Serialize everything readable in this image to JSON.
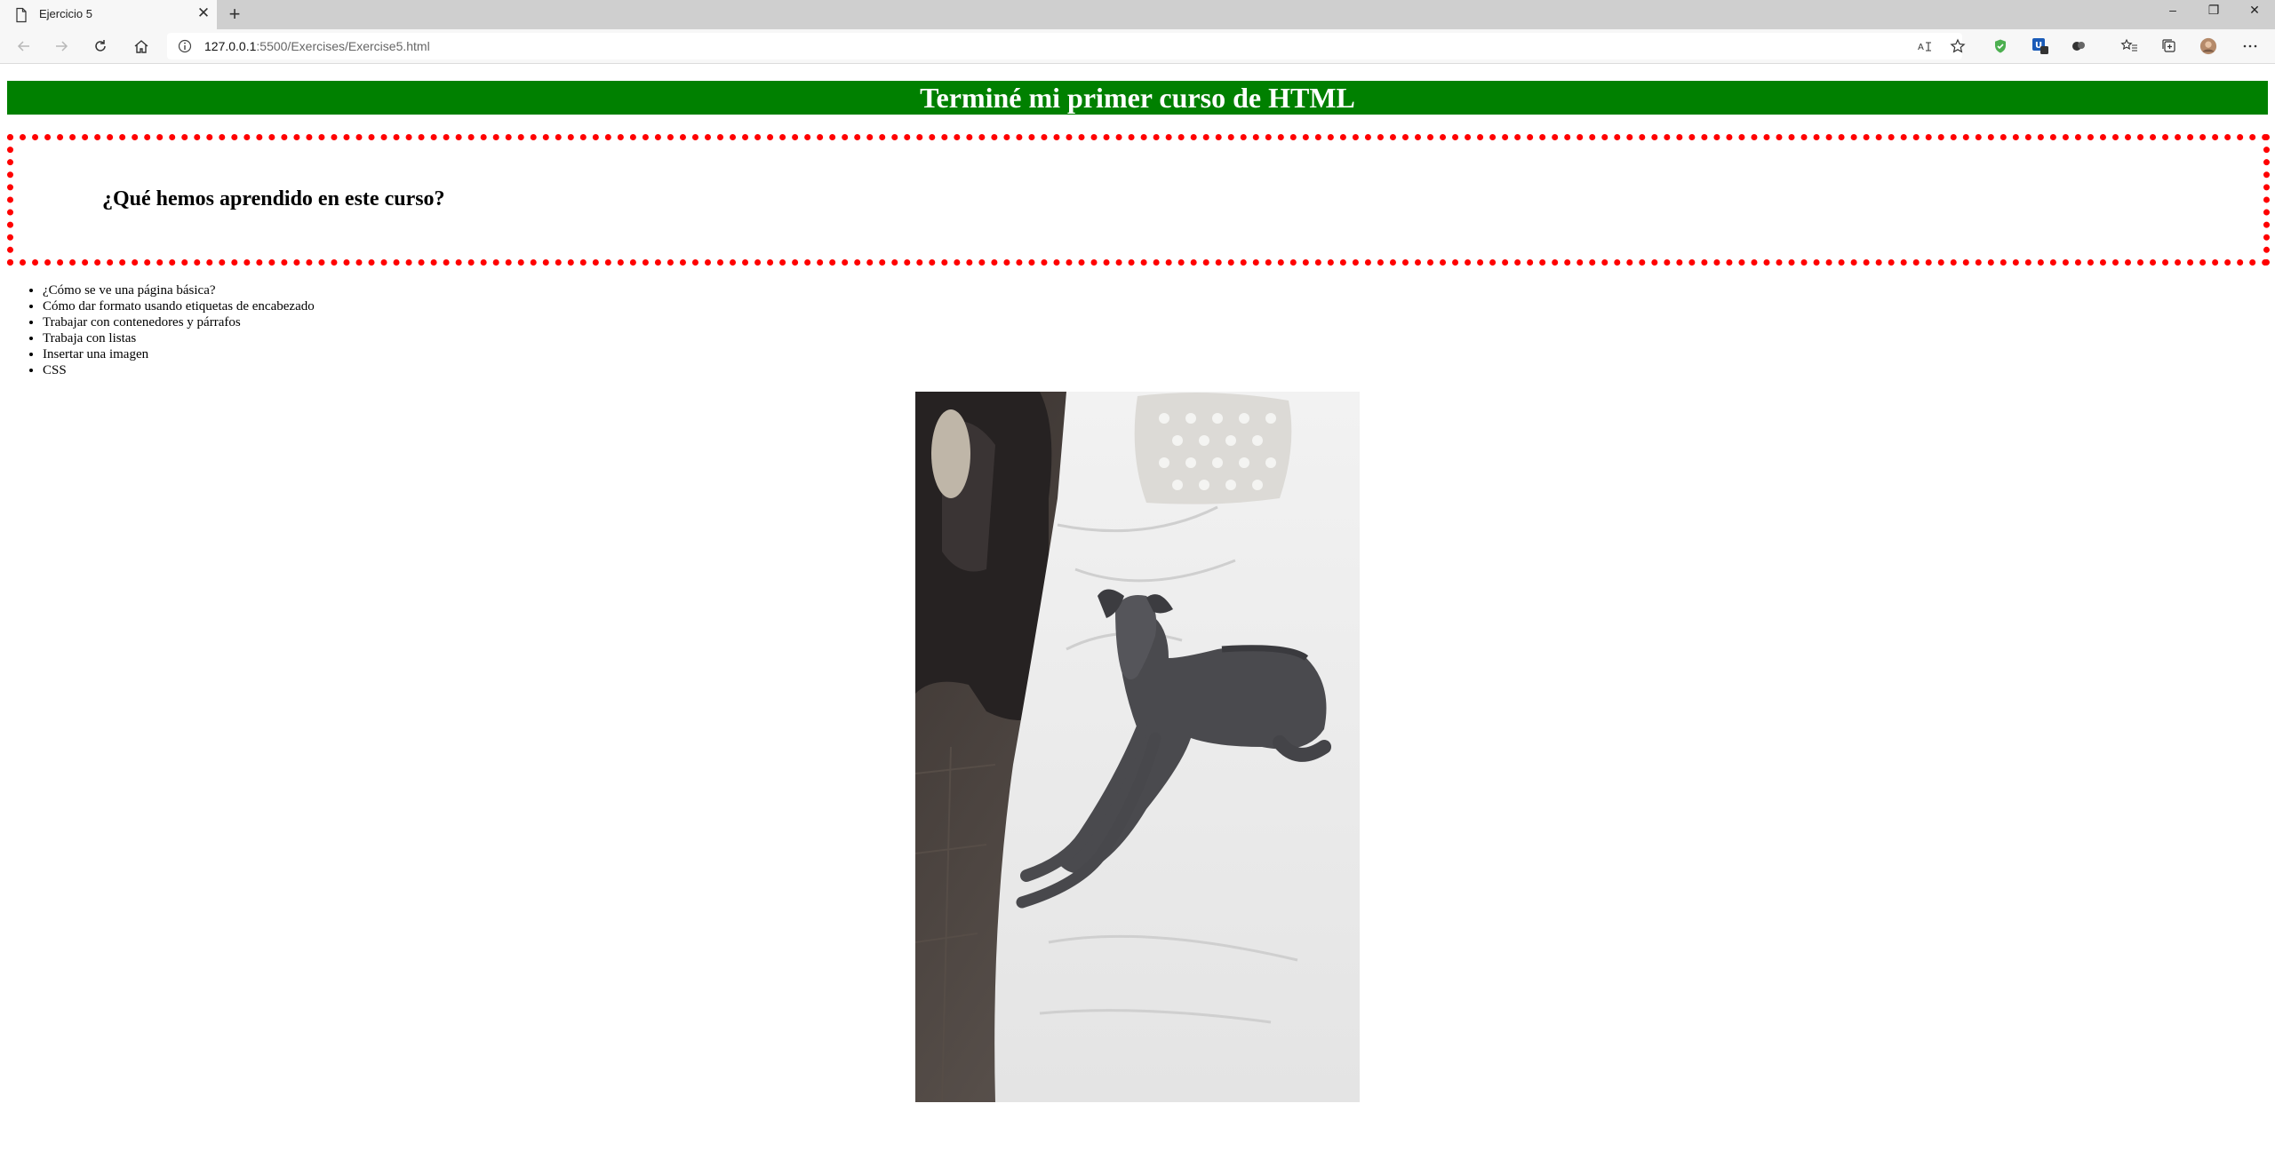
{
  "browser": {
    "tab_title": "Ejercicio 5",
    "url_host": "127.0.0.1",
    "url_rest": ":5500/Exercises/Exercise5.html"
  },
  "page": {
    "title": "Terminé mi primer curso de HTML",
    "question": "¿Qué hemos aprendido en este curso?",
    "topics": [
      "¿Cómo se ve una página básica?",
      "Cómo dar formato usando etiquetas de encabezado",
      "Trabajar con contenedores y párrafos",
      "Trabaja con listas",
      "Insertar una imagen",
      "CSS"
    ]
  },
  "colors": {
    "title_bg": "#008000",
    "border": "#ff0000"
  }
}
